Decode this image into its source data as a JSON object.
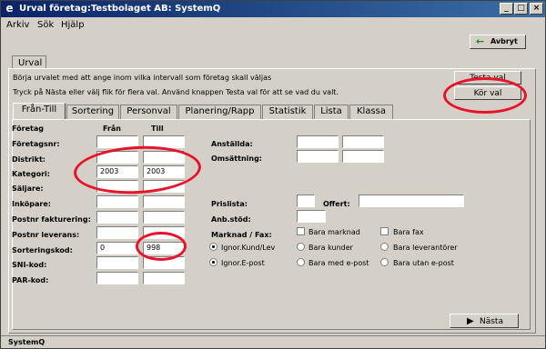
{
  "window": {
    "title": "Urval företag:Testbolaget AB: SystemQ",
    "icon": "e"
  },
  "menu": [
    "Arkiv",
    "Sök",
    "Hjälp"
  ],
  "toolbar": {
    "cancel_label": "Avbryt"
  },
  "outer_tab": "Urval",
  "info": {
    "line1": "Börja urvalet med att ange inom vilka intervall som företag skall väljas",
    "line2": "Tryck på Nästa eller välj flik för flera val. Använd knappen Testa val för att se vad du valt."
  },
  "buttons": {
    "test": "Testa val",
    "run": "Kör val",
    "next": "Nästa"
  },
  "tabs": [
    "Från-Till",
    "Sortering",
    "Personval",
    "Planering/Rapp",
    "Statistik",
    "Lista",
    "Klassa"
  ],
  "columns": {
    "section": "Företag",
    "from": "Från",
    "to": "Till"
  },
  "rows": [
    {
      "label": "Företagsnr:",
      "from": "",
      "to": ""
    },
    {
      "label": "Distrikt:",
      "from": "",
      "to": ""
    },
    {
      "label": "Kategori:",
      "from": "2003",
      "to": "2003"
    },
    {
      "label": "Säljare:",
      "from": "",
      "to": ""
    },
    {
      "label": "Inköpare:",
      "from": "",
      "to": ""
    },
    {
      "label": "Postnr fakturering:",
      "from": "",
      "to": ""
    },
    {
      "label": "Postnr leverans:",
      "from": "",
      "to": ""
    },
    {
      "label": "Sorteringskod:",
      "from": "0",
      "to": "998"
    },
    {
      "label": "SNI-kod:",
      "from": "",
      "to": ""
    },
    {
      "label": "PAR-kod:",
      "from": "",
      "to": ""
    }
  ],
  "right": {
    "anstallda": "Anställda:",
    "omsattning": "Omsättning:",
    "prislista": "Prislista:",
    "offert": "Offert:",
    "anbstod": "Anb.stöd:",
    "marknad": "Marknad / Fax:",
    "bara_marknad": "Bara marknad",
    "bara_fax": "Bara fax",
    "ignor_kund": "Ignor.Kund/Lev",
    "bara_kunder": "Bara kunder",
    "bara_leverantorer": "Bara leverantörer",
    "ignor_epost": "Ignor.E-post",
    "bara_med_epost": "Bara med e-post",
    "bara_utan_epost": "Bara utan e-post"
  },
  "status": "SystemQ",
  "colors": {
    "annotation": "#e8132a",
    "titlebar": "#0a246a",
    "face": "#d4d0c8"
  }
}
